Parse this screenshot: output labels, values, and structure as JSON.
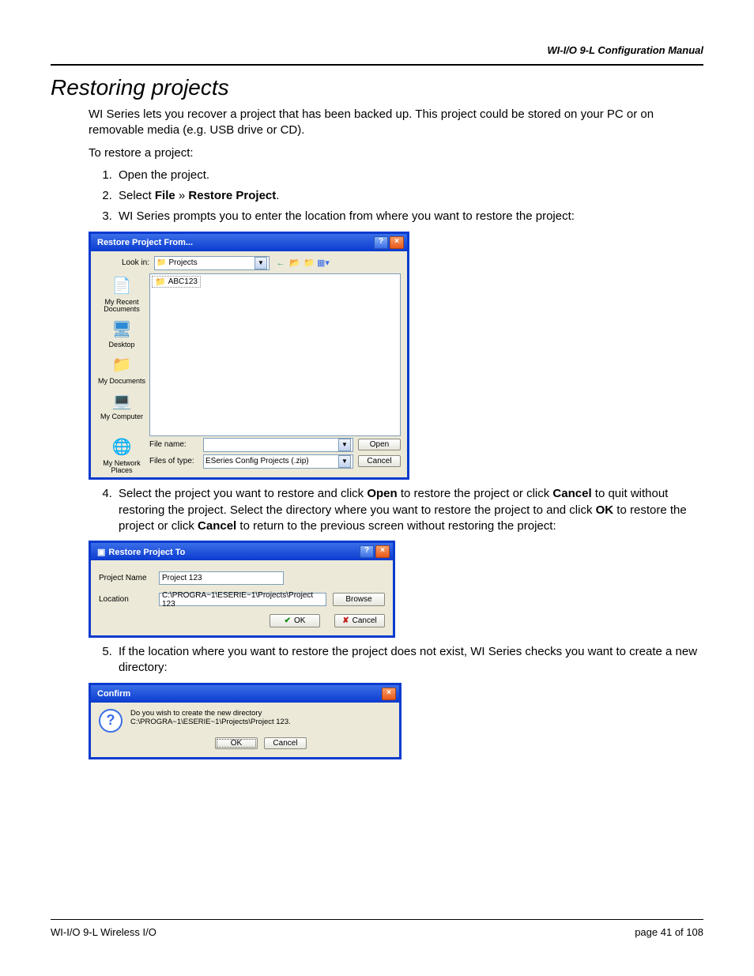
{
  "header": {
    "manual_title": "WI-I/O 9-L Configuration Manual"
  },
  "section": {
    "title": "Restoring projects",
    "intro": "WI Series lets you recover a project that has been backed up. This project could be stored on your PC or on removable media (e.g. USB drive or CD).",
    "lead": "To restore a project:",
    "steps": {
      "s1": "Open the project.",
      "s2_pre": "Select ",
      "s2_b1": "File",
      "s2_mid": " » ",
      "s2_b2": "Restore Project",
      "s2_post": ".",
      "s3": "WI Series prompts you to enter the location from where you want to restore the project:",
      "s4_a": "Select the project you want to restore and click ",
      "s4_b1": "Open",
      "s4_b": " to restore the project or click ",
      "s4_b2": "Cancel",
      "s4_c": " to quit without restoring the project. Select the directory where you want to restore the project to and click ",
      "s4_b3": "OK",
      "s4_d": " to restore the project or click ",
      "s4_b4": "Cancel",
      "s4_e": " to return to the previous screen without restoring the project:",
      "s5": "If the location where you want to restore the project does not exist, WI Series checks you want to create a new directory:"
    }
  },
  "dlg1": {
    "title": "Restore Project From...",
    "lookin_label": "Look in:",
    "lookin_value": "Projects",
    "file_item": "ABC123",
    "side": {
      "recent": "My Recent Documents",
      "desktop": "Desktop",
      "mydocs": "My Documents",
      "mycomp": "My Computer",
      "netplaces": "My Network Places"
    },
    "filename_label": "File name:",
    "filename_value": "",
    "filetype_label": "Files of type:",
    "filetype_value": "ESeries Config Projects (.zip)",
    "open_btn": "Open",
    "cancel_btn": "Cancel"
  },
  "dlg2": {
    "title": "Restore Project To",
    "proj_label": "Project Name",
    "proj_value": "Project 123",
    "loc_label": "Location",
    "loc_value": "C:\\PROGRA~1\\ESERIE~1\\Projects\\Project 123",
    "browse_btn": "Browse",
    "ok_btn": "OK",
    "cancel_btn": "Cancel"
  },
  "dlg3": {
    "title": "Confirm",
    "message": "Do you wish to create the new directory C:\\PROGRA~1\\ESERIE~1\\Projects\\Project 123.",
    "ok_btn": "OK",
    "cancel_btn": "Cancel"
  },
  "footer": {
    "left": "WI-I/O 9-L Wireless I/O",
    "right_pre": "page ",
    "page_cur": "41",
    "right_mid": " of ",
    "page_total": "108"
  }
}
